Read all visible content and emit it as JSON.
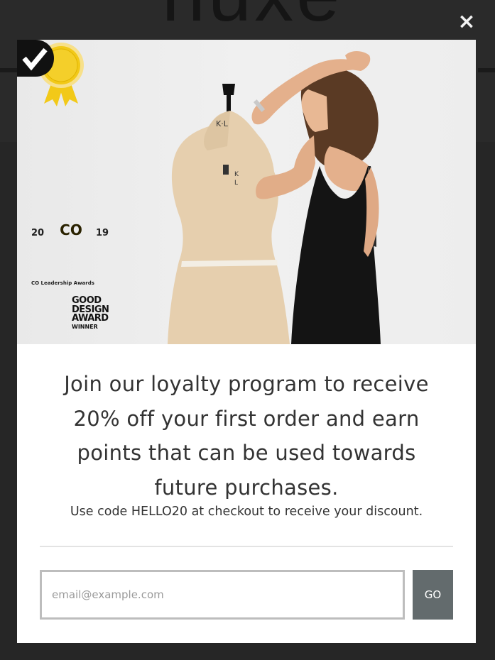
{
  "background": {
    "logo_text": "nuxe"
  },
  "modal": {
    "close_label": "×",
    "awards": {
      "year_left": "20",
      "seal_text": "CO",
      "year_right": "19",
      "caption": "CO Leadership Awards",
      "good_design": {
        "line1": "GOOD",
        "line2": "DESIGN",
        "line3": "AWARD",
        "line4": "WINNER"
      }
    },
    "headline_lines": [
      "Join our loyalty program to receive",
      "20% off your first order and earn",
      "points that can be used towards",
      "future purchases."
    ],
    "subtext": "Use code HELLO20 at checkout to receive your discount.",
    "email": {
      "placeholder": "email@example.com",
      "value": ""
    },
    "go_label": "GO"
  },
  "colors": {
    "overlay": "#2a2a2a",
    "button": "#636b6d",
    "seal": "#f2c918"
  },
  "icons": {
    "close": "close-icon",
    "award": "award-ribbon-icon",
    "good_design": "good-design-logo-icon"
  }
}
